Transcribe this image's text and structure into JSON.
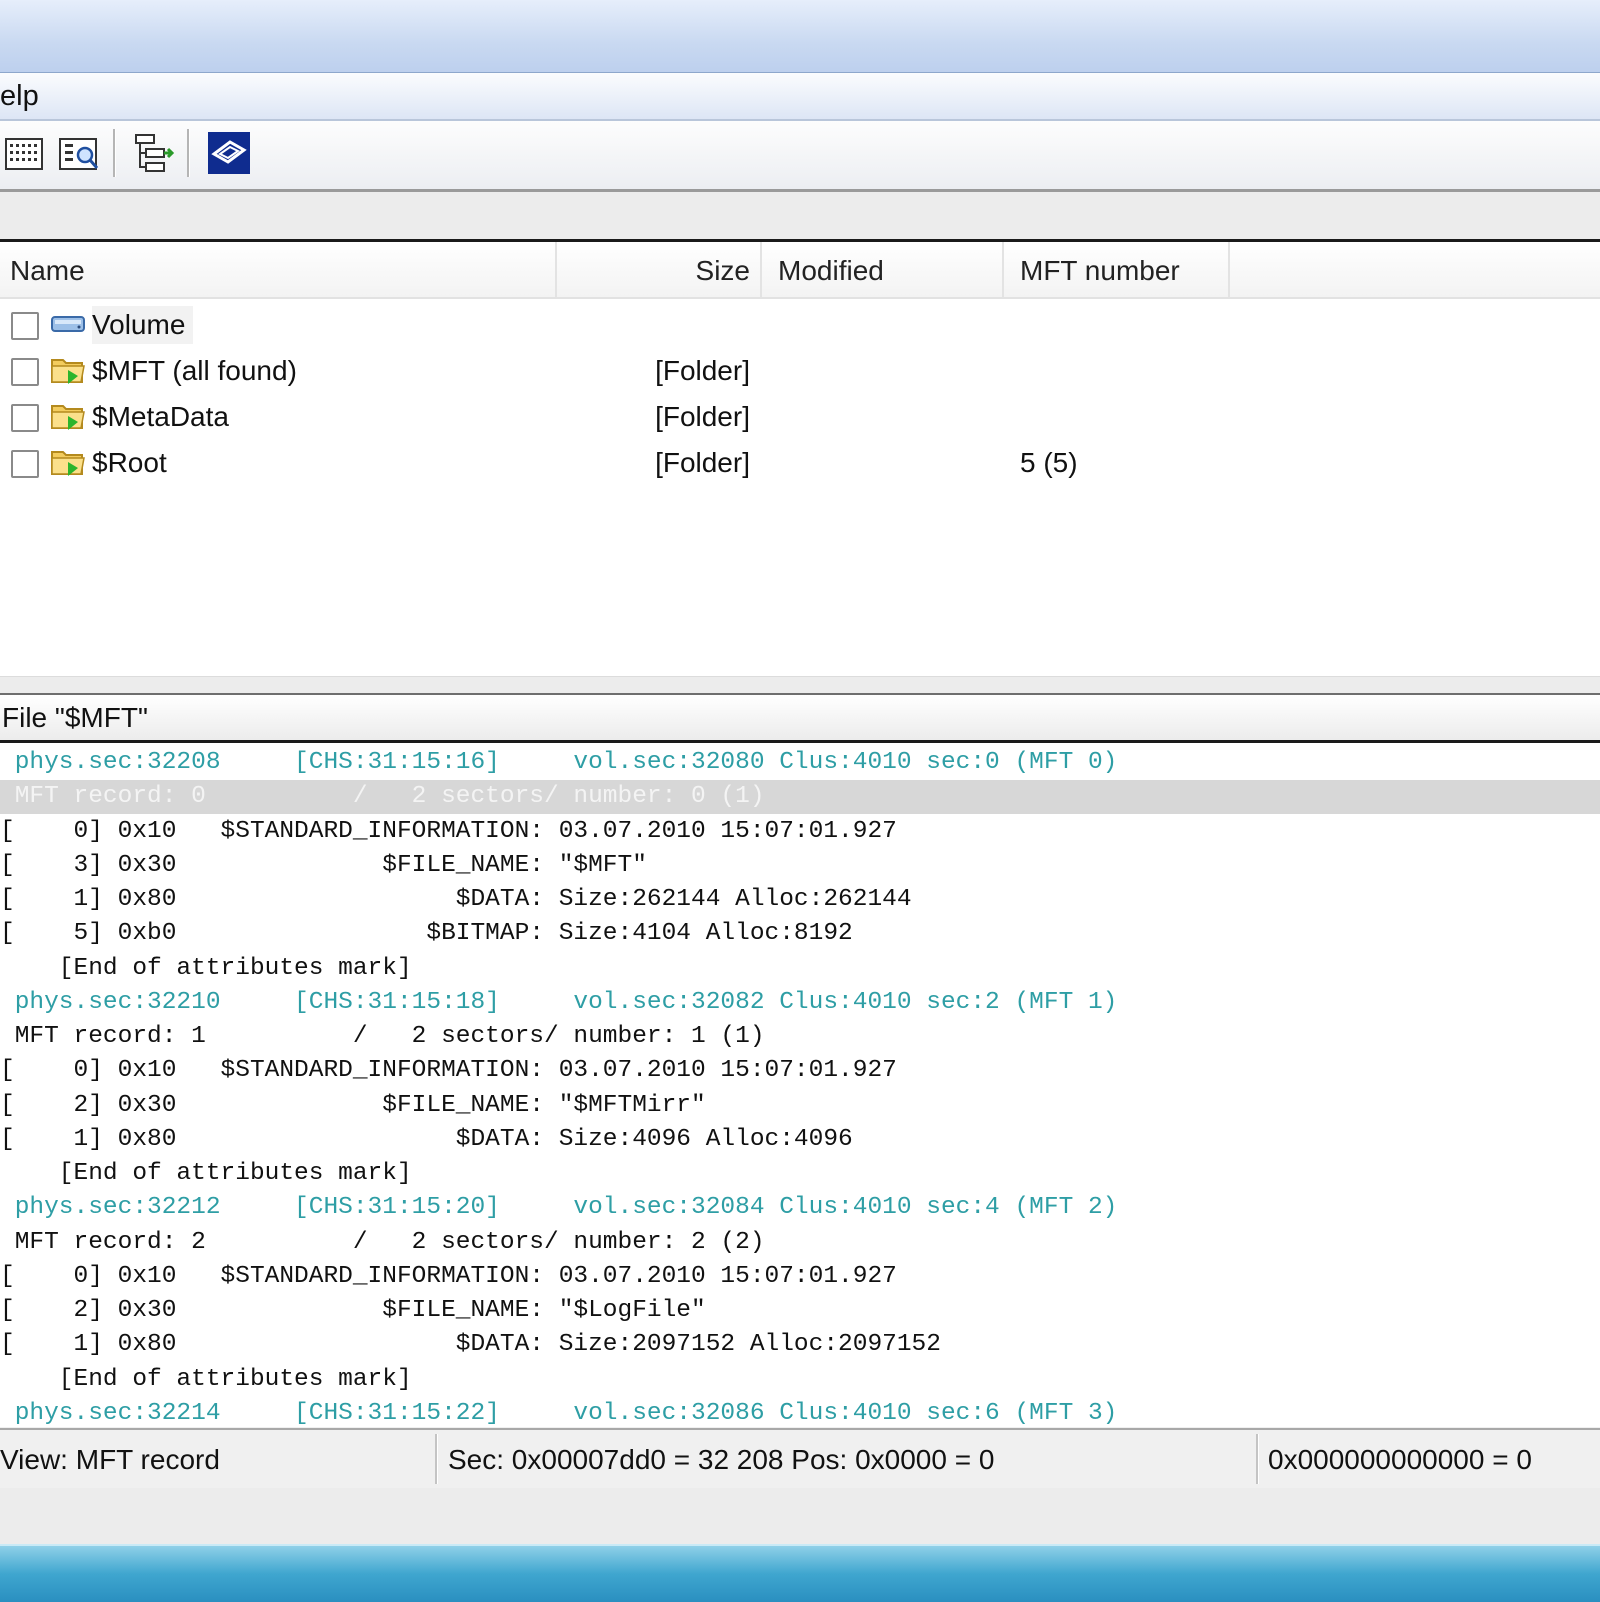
{
  "menu": {
    "help_label": "elp"
  },
  "toolbar": {
    "buttons": [
      "hex-view-icon",
      "properties-search-icon",
      "tree-export-icon",
      "app-logo-icon"
    ]
  },
  "file_list": {
    "columns": {
      "name": "Name",
      "size": "Size",
      "modified": "Modified",
      "mft_number": "MFT number"
    },
    "rows": [
      {
        "name": "Volume",
        "size": "",
        "modified": "",
        "mft": "",
        "icon": "drive-icon"
      },
      {
        "name": "$MFT (all found)",
        "size": "[Folder]",
        "modified": "",
        "mft": "",
        "icon": "folder-icon"
      },
      {
        "name": "$MetaData",
        "size": "[Folder]",
        "modified": "",
        "mft": "",
        "icon": "folder-icon"
      },
      {
        "name": "$Root",
        "size": "[Folder]",
        "modified": "",
        "mft": "5 (5)",
        "icon": "folder-icon"
      }
    ]
  },
  "file_header": {
    "title": "File \"$MFT\""
  },
  "hex_view": {
    "lines": [
      {
        "type": "phys",
        "text": " phys.sec:32208     [CHS:31:15:16]     vol.sec:32080 Clus:4010 sec:0 (MFT 0)"
      },
      {
        "type": "sel",
        "text": " MFT record: 0          /   2 sectors/ number: 0 (1)"
      },
      {
        "type": "attr",
        "text": "[    0] 0x10   $STANDARD_INFORMATION: 03.07.2010 15:07:01.927"
      },
      {
        "type": "attr",
        "text": "[    3] 0x30              $FILE_NAME: \"$MFT\""
      },
      {
        "type": "attr",
        "text": "[    1] 0x80                   $DATA: Size:262144 Alloc:262144"
      },
      {
        "type": "attr",
        "text": "[    5] 0xb0                 $BITMAP: Size:4104 Alloc:8192"
      },
      {
        "type": "attr",
        "text": "    [End of attributes mark]"
      },
      {
        "type": "phys",
        "text": " phys.sec:32210     [CHS:31:15:18]     vol.sec:32082 Clus:4010 sec:2 (MFT 1)"
      },
      {
        "type": "rec",
        "text": " MFT record: 1          /   2 sectors/ number: 1 (1)"
      },
      {
        "type": "attr",
        "text": "[    0] 0x10   $STANDARD_INFORMATION: 03.07.2010 15:07:01.927"
      },
      {
        "type": "attr",
        "text": "[    2] 0x30              $FILE_NAME: \"$MFTMirr\""
      },
      {
        "type": "attr",
        "text": "[    1] 0x80                   $DATA: Size:4096 Alloc:4096"
      },
      {
        "type": "attr",
        "text": "    [End of attributes mark]"
      },
      {
        "type": "phys",
        "text": " phys.sec:32212     [CHS:31:15:20]     vol.sec:32084 Clus:4010 sec:4 (MFT 2)"
      },
      {
        "type": "rec",
        "text": " MFT record: 2          /   2 sectors/ number: 2 (2)"
      },
      {
        "type": "attr",
        "text": "[    0] 0x10   $STANDARD_INFORMATION: 03.07.2010 15:07:01.927"
      },
      {
        "type": "attr",
        "text": "[    2] 0x30              $FILE_NAME: \"$LogFile\""
      },
      {
        "type": "attr",
        "text": "[    1] 0x80                   $DATA: Size:2097152 Alloc:2097152"
      },
      {
        "type": "attr",
        "text": "    [End of attributes mark]"
      },
      {
        "type": "phys",
        "text": " phys.sec:32214     [CHS:31:15:22]     vol.sec:32086 Clus:4010 sec:6 (MFT 3)"
      }
    ]
  },
  "status": {
    "view": "View: MFT record",
    "sector": "Sec: 0x00007dd0 = 32 208  Pos: 0x0000 = 0",
    "offset": "0x000000000000 = 0"
  },
  "colors": {
    "phys_line": "#2e9ea5",
    "selection": "#d7d7d7"
  }
}
